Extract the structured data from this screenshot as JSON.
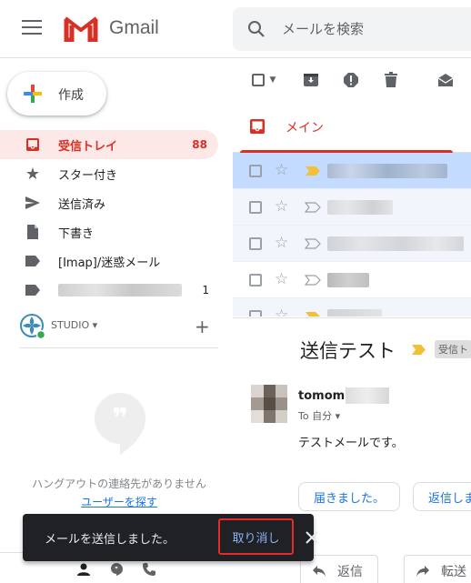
{
  "header": {
    "app_name": "Gmail",
    "search_placeholder": "メールを検索"
  },
  "compose": {
    "label": "作成"
  },
  "sidebar": {
    "items": [
      {
        "label": "受信トレイ",
        "count": "88",
        "icon": "inbox-icon",
        "active": true
      },
      {
        "label": "スター付き",
        "count": "",
        "icon": "star-icon"
      },
      {
        "label": "送信済み",
        "count": "",
        "icon": "send-icon"
      },
      {
        "label": "下書き",
        "count": "",
        "icon": "draft-icon"
      },
      {
        "label": "[Imap]/迷惑メール",
        "count": "",
        "icon": "label-icon"
      },
      {
        "label": "",
        "count": "1",
        "icon": "label-icon"
      }
    ]
  },
  "hangouts": {
    "name": "STUDIO",
    "empty_text": "ハングアウトの連絡先がありません",
    "find_link": "ユーザーを探す"
  },
  "tabs": {
    "main": "メイン"
  },
  "colors": {
    "accent": "#d93025",
    "selected_row": "#c2dbff",
    "important": "#f2c037",
    "link": "#1a73e8"
  },
  "reading": {
    "subject": "送信テスト",
    "label_chip": "受信ト",
    "sender": "tomomi",
    "to_line": "To 自分 ▾",
    "body": "テストメールです。",
    "smart_replies": [
      "届きました。",
      "返信しま"
    ],
    "reply_button": "返信",
    "forward_button": "転送"
  },
  "snackbar": {
    "message": "メールを送信しました。",
    "undo": "取り消し"
  }
}
